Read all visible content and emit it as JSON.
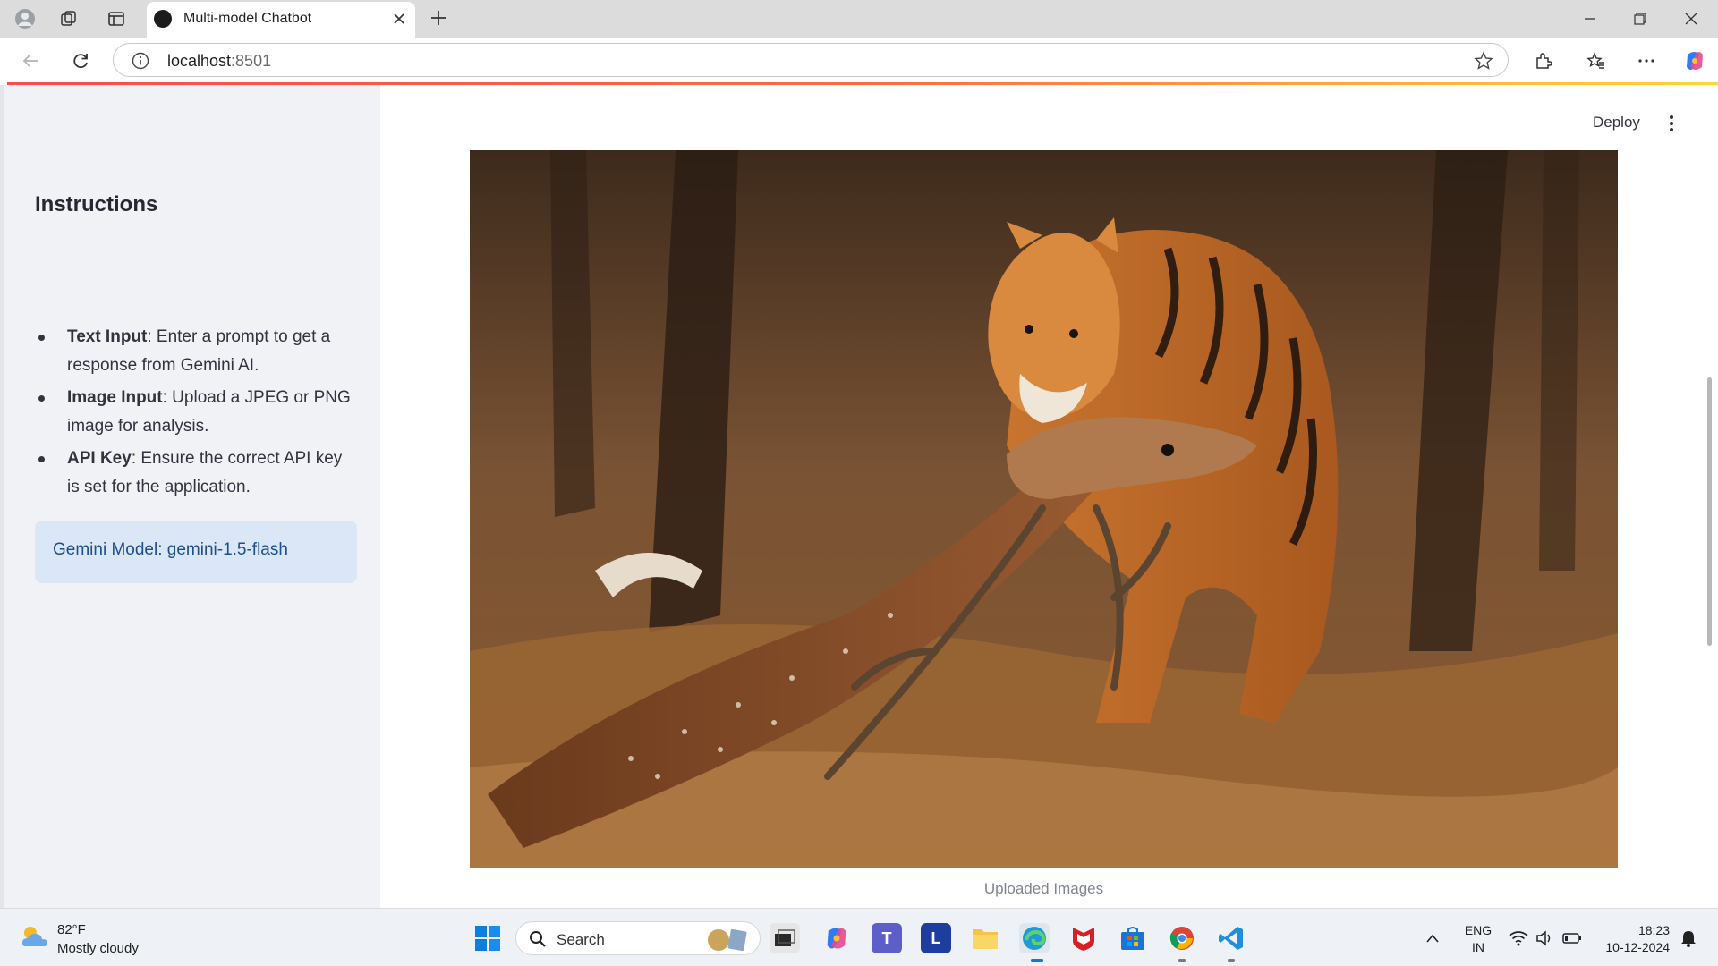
{
  "browser": {
    "tab_title": "Multi-model Chatbot",
    "url_host": "localhost",
    "url_port": ":8501"
  },
  "sidebar": {
    "title": "Instructions",
    "items": [
      {
        "term": "Text Input",
        "desc": ": Enter a prompt to get a response from Gemini AI."
      },
      {
        "term": "Image Input",
        "desc": ": Upload a JPEG or PNG image for analysis."
      },
      {
        "term": "API Key",
        "desc": ": Ensure the correct API key is set for the application."
      }
    ],
    "model_info": "Gemini Model: gemini-1.5-flash"
  },
  "header": {
    "deploy_label": "Deploy"
  },
  "main": {
    "image_caption": "Uploaded Images"
  },
  "taskbar": {
    "weather_temp": "82°F",
    "weather_desc": "Mostly cloudy",
    "search_label": "Search",
    "lang_line1": "ENG",
    "lang_line2": "IN",
    "time": "18:23",
    "date": "10-12-2024"
  },
  "colors": {
    "accent": "#ff4b4b",
    "sidebar_bg": "#f0f2f6",
    "info_box_bg": "#dbe7f6",
    "info_box_text": "#1c4f8c"
  }
}
